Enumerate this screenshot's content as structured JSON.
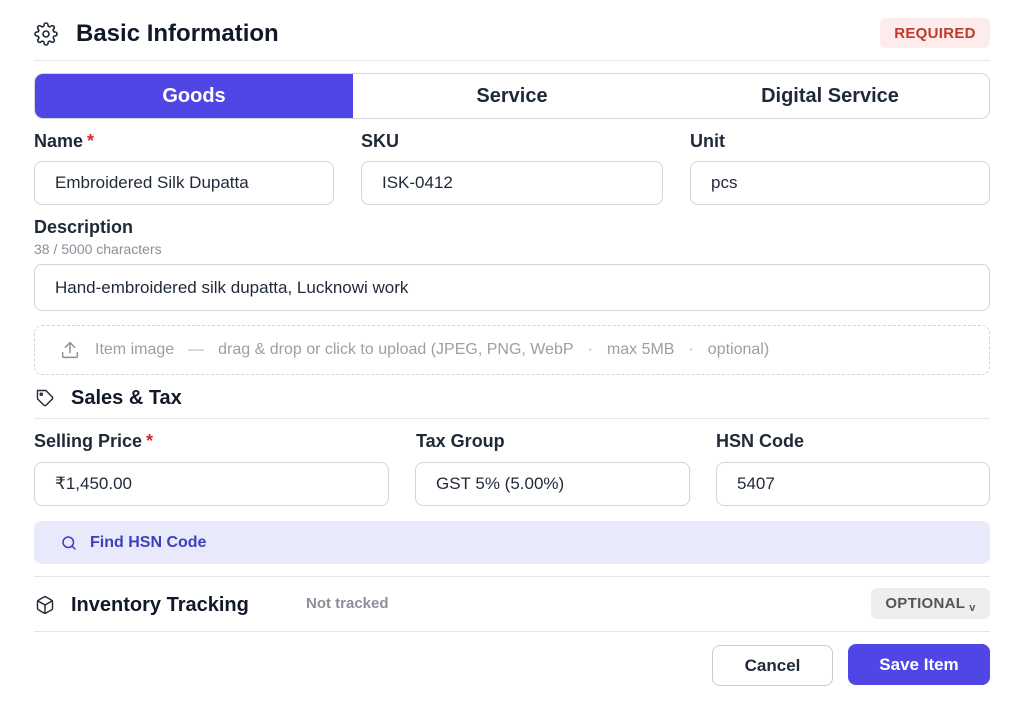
{
  "basic_info": {
    "title": "Basic Information",
    "badge": "REQUIRED",
    "icon": "gear-icon"
  },
  "tabs": [
    {
      "label": "Goods",
      "active": true
    },
    {
      "label": "Service",
      "active": false
    },
    {
      "label": "Digital Service",
      "active": false
    }
  ],
  "fields": {
    "name": {
      "label": "Name",
      "required_mark": "*",
      "value": "Embroidered Silk Dupatta"
    },
    "sku": {
      "label": "SKU",
      "value": "ISK-0412"
    },
    "unit": {
      "label": "Unit",
      "value": "pcs"
    },
    "description": {
      "label": "Description",
      "counter": "38 / 5000 characters",
      "value": "Hand-embroidered silk dupatta, Lucknowi work"
    }
  },
  "upload": {
    "icon": "upload-icon",
    "label": "Item image",
    "dash": "—",
    "instructions": "drag & drop or click to upload (JPEG, PNG, WebP",
    "dot1": "·",
    "max_size": "max 5MB",
    "dot2": "·",
    "optional": "optional)"
  },
  "sales_tax": {
    "title": "Sales & Tax",
    "icon": "tag-icon",
    "selling_price": {
      "label": "Selling Price",
      "required_mark": "*",
      "value": "₹1,450.00"
    },
    "tax_group": {
      "label": "Tax Group",
      "value": "GST 5% (5.00%)"
    },
    "hsn_code": {
      "label": "HSN Code",
      "value": "5407"
    },
    "find_hsn_label": "Find HSN Code"
  },
  "inventory": {
    "title": "Inventory Tracking",
    "icon": "box-icon",
    "status": "Not tracked",
    "badge": "OPTIONAL",
    "chevron": "v"
  },
  "actions": {
    "cancel_label": "Cancel",
    "save_label": "Save Item"
  },
  "colors": {
    "accent": "#4f46e5",
    "required_text": "#c0392b",
    "required_bg": "#fdecec",
    "hsn_bg": "#e8eafc"
  }
}
